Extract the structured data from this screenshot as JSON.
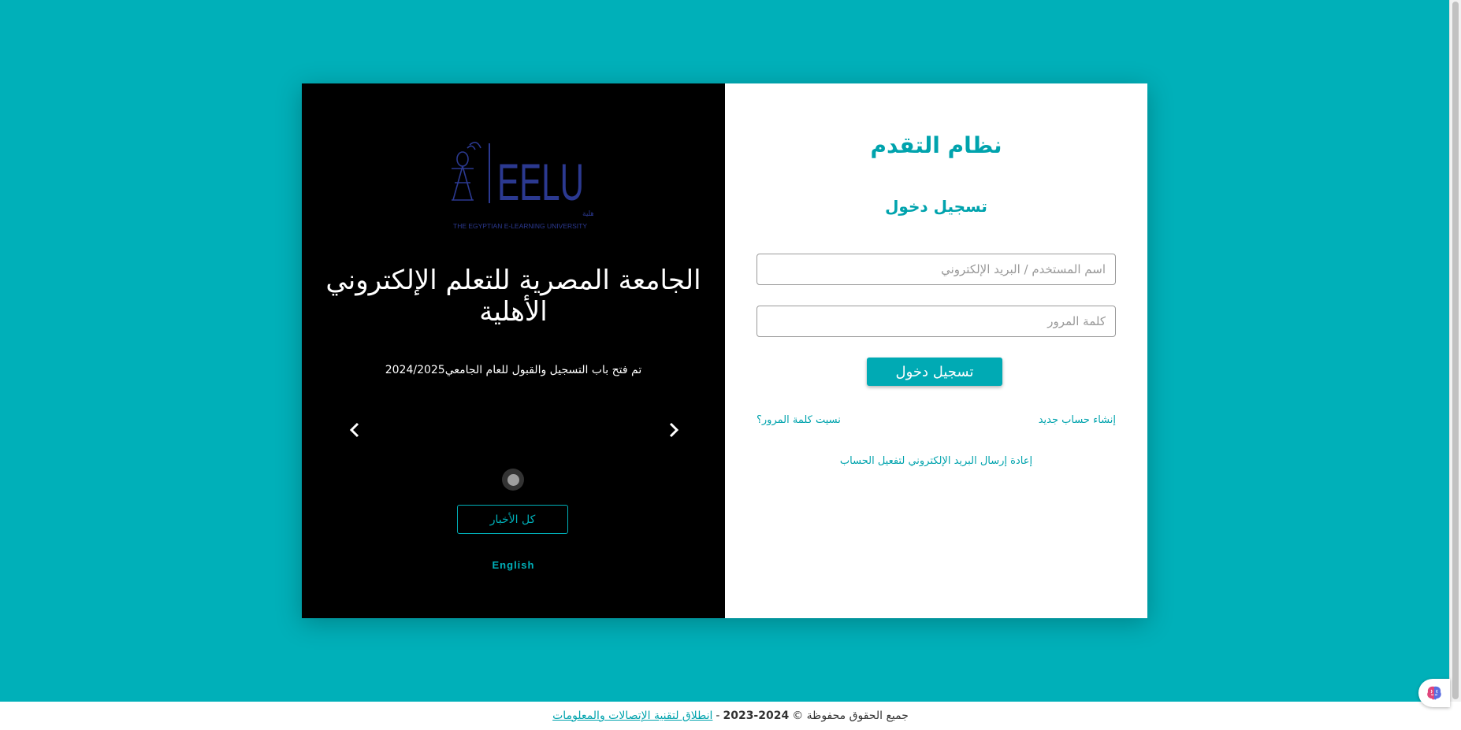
{
  "left_panel": {
    "logo": {
      "icon": "ankh-lamp-icon",
      "brand": "EELU",
      "arabic_name": "الجامعة المصرية للتعلم الإلكتروني الأهلية",
      "english_name": "THE EGYPTIAN E-LEARNING UNIVERSITY"
    },
    "university_title": "الجامعة المصرية للتعلم الإلكتروني الأهلية",
    "news_text": "تم فتح باب التسجيل والقبول للعام الجامعي2024/2025",
    "all_news_label": "كل الأخبار",
    "language_label": "English"
  },
  "right_panel": {
    "system_title": "نظام التقدم",
    "login_title": "تسجيل دخول",
    "username": {
      "value": "",
      "placeholder": "اسم المستخدم / البريد الإلكتروني"
    },
    "password": {
      "value": "",
      "placeholder": "كلمة المرور"
    },
    "login_button": "تسجيل دخول",
    "create_account": "إنشاء حساب جديد",
    "forgot_password": "نسيت كلمة المرور؟",
    "resend_activation": "إعادة إرسال البريد الإلكتروني لتفعيل الحساب"
  },
  "footer": {
    "rights": "جميع الحقوق محفوظة ©",
    "years": "2023-2024",
    "separator": "-",
    "company_link": "انطلاق لتقنية الإتصالات والمعلومات"
  },
  "colors": {
    "accent": "#00b0b9",
    "panel_dark": "#000000",
    "logo_blue": "#2b3990"
  }
}
